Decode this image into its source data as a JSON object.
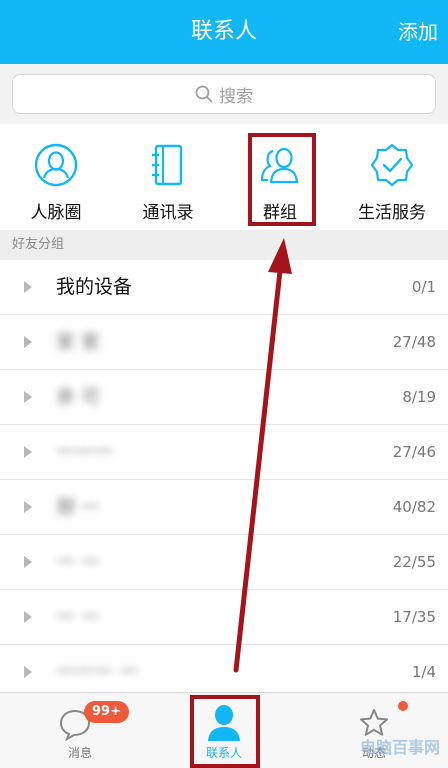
{
  "header": {
    "title": "联系人",
    "add_label": "添加"
  },
  "search": {
    "placeholder": "搜索"
  },
  "quick_actions": [
    {
      "label": "人脉圈",
      "icon": "circle-person-icon"
    },
    {
      "label": "通讯录",
      "icon": "address-book-icon"
    },
    {
      "label": "群组",
      "icon": "group-icon"
    },
    {
      "label": "生活服务",
      "icon": "service-badge-icon"
    }
  ],
  "section": {
    "label": "好友分组"
  },
  "groups": [
    {
      "name": "我的设备",
      "count": "0/1",
      "blurred": false
    },
    {
      "name": "家 家",
      "count": "27/48",
      "blurred": true
    },
    {
      "name": "亲 可",
      "count": "8/19",
      "blurred": true
    },
    {
      "name": "一一一",
      "count": "27/46",
      "blurred": true
    },
    {
      "name": "朋 一",
      "count": "40/82",
      "blurred": true
    },
    {
      "name": "一 一",
      "count": "22/55",
      "blurred": true
    },
    {
      "name": "一 一",
      "count": "17/35",
      "blurred": true
    },
    {
      "name": "一一一 一",
      "count": "1/4",
      "blurred": true
    }
  ],
  "tabs": {
    "messages": {
      "label": "消息",
      "badge": "99+"
    },
    "contacts": {
      "label": "联系人"
    },
    "feed": {
      "label": "动态"
    }
  },
  "watermark": "电脑百事网",
  "colors": {
    "accent": "#12b7f5",
    "highlight": "#a6141b",
    "badge": "#f05a3c"
  }
}
